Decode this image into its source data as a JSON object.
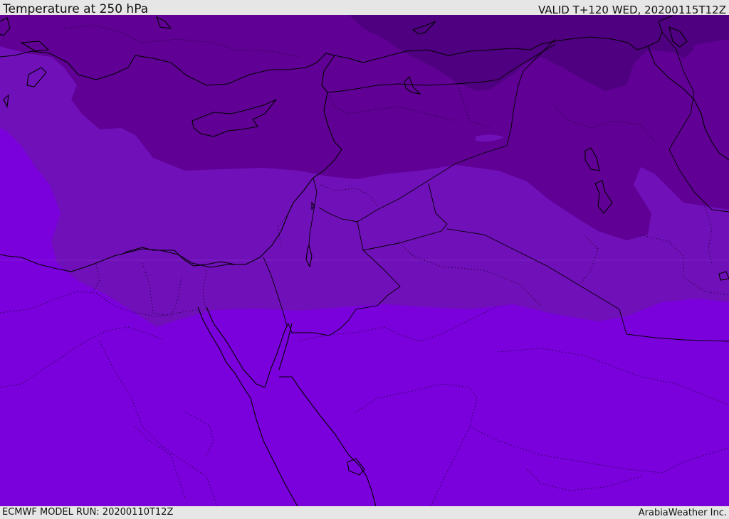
{
  "header": {
    "title": "Temperature at 250 hPa",
    "valid": "VALID T+120 WED, 20200115T12Z"
  },
  "footer": {
    "model_run": "ECMWF MODEL RUN: 20200110T12Z",
    "credit": "ArabiaWeather Inc."
  },
  "map": {
    "colors": {
      "band_coldest": "#4f0080",
      "band_cold": "#600095",
      "band_mid": "#7010b8",
      "band_warm": "#7a00dc",
      "coast": "#000000",
      "border": "#000000"
    }
  }
}
